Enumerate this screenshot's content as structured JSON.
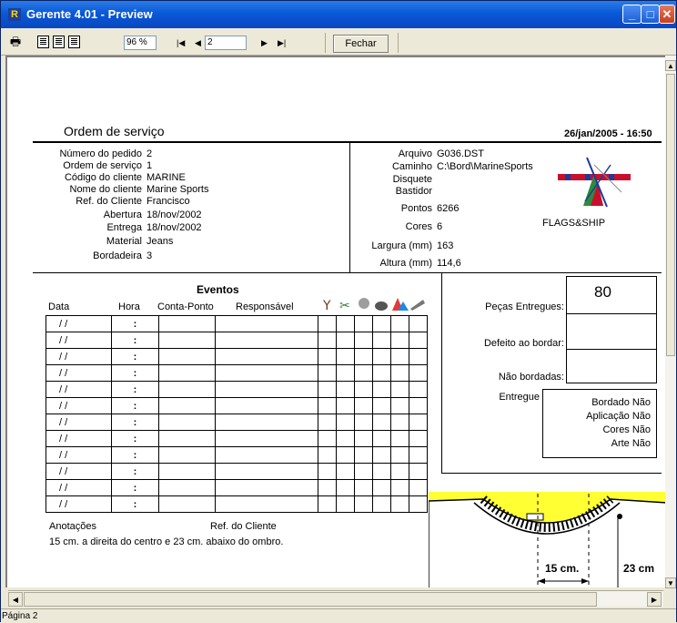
{
  "window": {
    "title": "Gerente 4.01 - Preview",
    "app_icon": "R"
  },
  "toolbar": {
    "zoom": "96 %",
    "page_number": "2",
    "close_label": "Fechar"
  },
  "status": {
    "text": "Página 2"
  },
  "report": {
    "title": "Ordem de serviço",
    "datetime": "26/jan/2005 - 16:50",
    "left_fields": [
      {
        "label": "Número do pedido",
        "value": "2"
      },
      {
        "label": "Ordem de serviço",
        "value": "1"
      },
      {
        "label": "Código do cliente",
        "value": "MARINE"
      },
      {
        "label": "Nome do cliente",
        "value": "Marine Sports"
      },
      {
        "label": "Ref. do Cliente",
        "value": "Francisco"
      },
      {
        "label": "Abertura",
        "value": "18/nov/2002"
      },
      {
        "label": "Entrega",
        "value": "18/nov/2002"
      },
      {
        "label": "Material",
        "value": "Jeans"
      },
      {
        "label": "Bordadeira",
        "value": "3"
      }
    ],
    "right_fields": [
      {
        "label": "Arquivo",
        "value": "G036.DST"
      },
      {
        "label": "Caminho",
        "value": "C:\\Bord\\MarineSports"
      },
      {
        "label": "Disquete",
        "value": ""
      },
      {
        "label": "Bastidor",
        "value": ""
      },
      {
        "label": "Pontos",
        "value": "6266"
      },
      {
        "label": "Cores",
        "value": "6"
      },
      {
        "label": "Largura (mm)",
        "value": "163"
      },
      {
        "label": "Altura (mm)",
        "value": "114,6"
      }
    ],
    "design_name": "FLAGS&SHIP",
    "events": {
      "title": "Eventos",
      "headers": {
        "data": "Data",
        "hora": "Hora",
        "conta_ponto": "Conta-Ponto",
        "responsavel": "Responsável"
      },
      "row_date": "/    /",
      "row_time": ":",
      "row_count": 12
    },
    "annotations": {
      "label": "Anotações",
      "ref_label": "Ref. do Cliente",
      "text": "15 cm. a direita do centro e 23 cm. abaixo do ombro."
    },
    "summary": {
      "pecas_entregues_label": "Peças Entregues:",
      "pecas_entregues_value": "80",
      "defeito_label": "Defeito ao bordar:",
      "nao_bordadas_label": "Não bordadas:",
      "entregue_label": "Entregue",
      "entregue_items": [
        {
          "label": "Bordado",
          "value": "Não"
        },
        {
          "label": "Aplicação",
          "value": "Não"
        },
        {
          "label": "Cores",
          "value": "Não"
        },
        {
          "label": "Arte",
          "value": "Não"
        }
      ]
    },
    "diagram": {
      "measure_h": "15 cm.",
      "measure_v": "23 cm"
    }
  }
}
